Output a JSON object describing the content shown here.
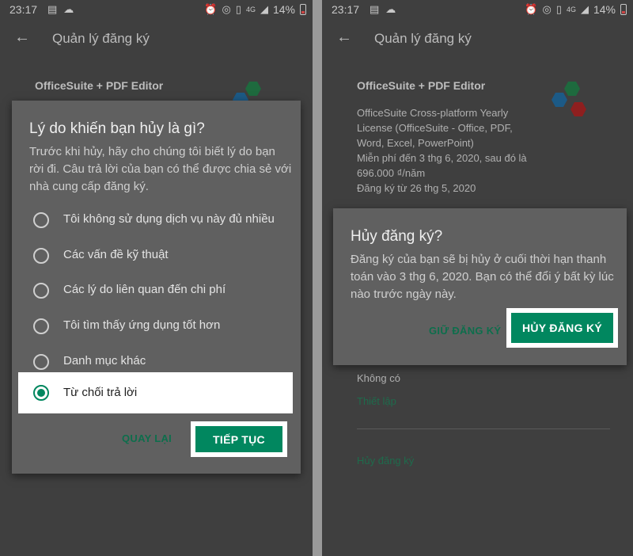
{
  "status_bar": {
    "time": "23:17",
    "network": "4G",
    "battery": "14%"
  },
  "app_bar": {
    "title": "Quản lý đăng ký"
  },
  "subscription": {
    "app_name": "OfficeSuite + PDF Editor",
    "details": [
      "OfficeSuite Cross-platform Yearly",
      "License (OfficeSuite - Office, PDF,",
      "Word, Excel, PowerPoint)",
      "Miễn phí đến 3 thg 6, 2020, sau đó là",
      "696.000 ₫/năm",
      "Đăng ký từ 26 thg 5, 2020"
    ],
    "payment_value": "Không có",
    "setup_link": "Thiết lập",
    "cancel_link": "Hủy đăng ký"
  },
  "reason_dialog": {
    "title": "Lý do khiến bạn hủy là gì?",
    "body_lines": [
      "Trước khi hủy, hãy cho chúng tôi biết lý do bạn",
      "rời đi. Câu trả lời của bạn có thể được chia sẻ với",
      "nhà cung cấp đăng ký."
    ],
    "options": [
      "Tôi không sử dụng dịch vụ này đủ nhiều",
      "Các vấn đề kỹ thuật",
      "Các lý do liên quan đến chi phí",
      "Tôi tìm thấy ứng dụng tốt hơn",
      "Danh mục khác",
      "Từ chối trả lời"
    ],
    "selected_index": 5,
    "back_label": "QUAY LẠI",
    "continue_label": "TIẾP TỤC"
  },
  "confirm_dialog": {
    "title": "Hủy đăng ký?",
    "body_lines": [
      "Đăng ký của bạn sẽ bị hủy ở cuối thời hạn thanh",
      "toán vào 3 thg 6, 2020. Bạn có thể đổi ý bất kỳ lúc",
      "nào trước ngày này."
    ],
    "keep_label": "GIỮ ĐĂNG KÝ",
    "cancel_label": "HỦY ĐĂNG KÝ"
  },
  "colors": {
    "accent": "#01875f",
    "scrim": "#3f3f3f",
    "dialog": "#606060"
  }
}
